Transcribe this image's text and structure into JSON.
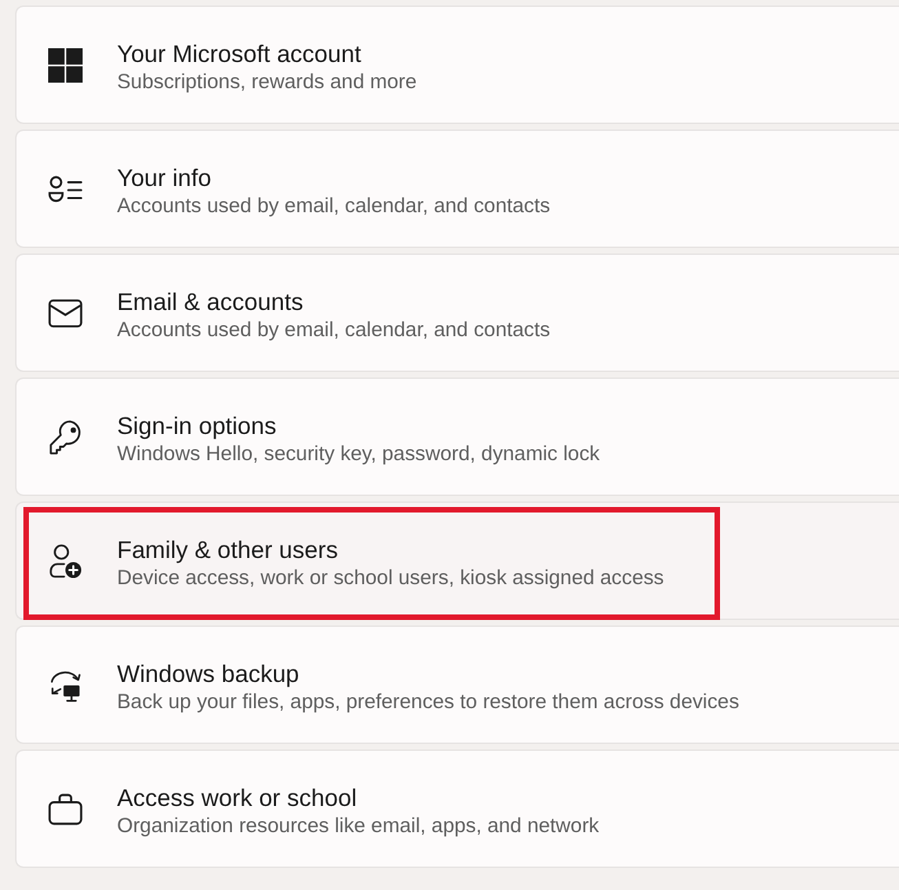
{
  "items": [
    {
      "title": "Your Microsoft account",
      "subtitle": "Subscriptions, rewards and more",
      "highlighted": false
    },
    {
      "title": "Your info",
      "subtitle": "Accounts used by email, calendar, and contacts",
      "highlighted": false
    },
    {
      "title": "Email & accounts",
      "subtitle": "Accounts used by email, calendar, and contacts",
      "highlighted": false
    },
    {
      "title": "Sign-in options",
      "subtitle": "Windows Hello, security key, password, dynamic lock",
      "highlighted": false
    },
    {
      "title": "Family & other users",
      "subtitle": "Device access, work or school users, kiosk assigned access",
      "highlighted": true
    },
    {
      "title": "Windows backup",
      "subtitle": "Back up your files, apps, preferences to restore them across devices",
      "highlighted": false
    },
    {
      "title": "Access work or school",
      "subtitle": "Organization resources like email, apps, and network",
      "highlighted": false
    }
  ]
}
